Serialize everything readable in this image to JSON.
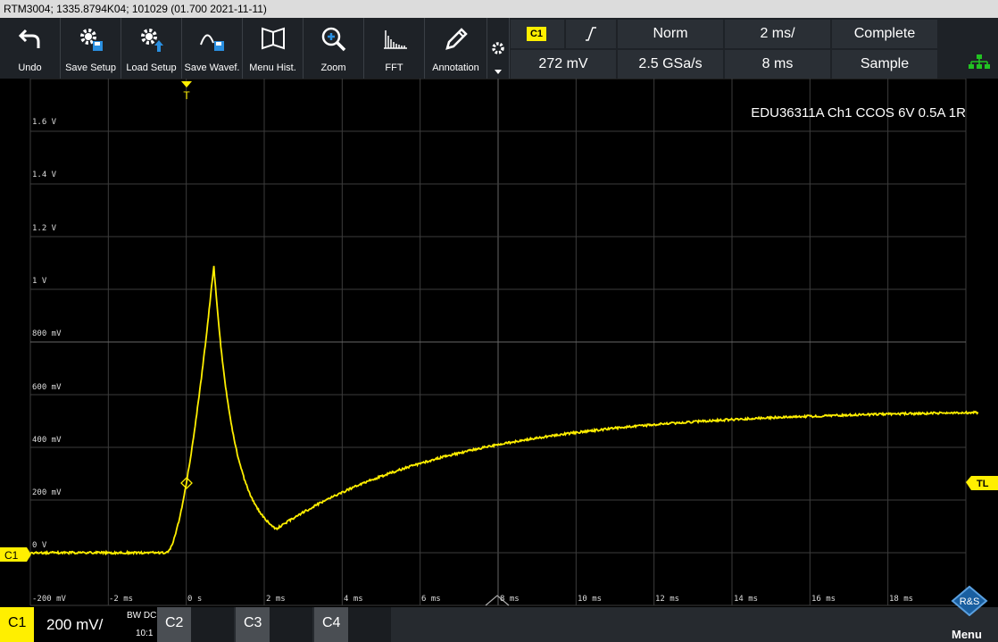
{
  "titlebar": {
    "text": "RTM3004; 1335.8794K04; 101029 (01.700 2021-11-11)"
  },
  "toolbar": {
    "undo": "Undo",
    "save_setup": "Save Setup",
    "load_setup": "Load Setup",
    "save_waveform": "Save Wavef.",
    "menu_hist": "Menu Hist.",
    "zoom": "Zoom",
    "fft": "FFT",
    "annotation": "Annotation"
  },
  "info": {
    "channel": "C1",
    "trigger_level": "272 mV",
    "trigger_mode": "Norm",
    "sample_rate": "2.5 GSa/s",
    "timebase": "2 ms/",
    "record_time": "8 ms",
    "acq_status": "Complete",
    "acq_mode": "Sample"
  },
  "plot": {
    "annotation": "EDU36311A Ch1 CCOS 6V 0.5A 1R",
    "trigger_marker": "T",
    "trigger_level_marker": "TL",
    "channel_marker": "C1",
    "y_labels": [
      "1.6 V",
      "1.4 V",
      "1.2 V",
      "1 V",
      "800 mV",
      "600 mV",
      "400 mV",
      "200 mV",
      "0 V",
      "-200 mV"
    ],
    "x_labels": [
      "-2 ms",
      "0 s",
      "2 ms",
      "4 ms",
      "6 ms",
      "8 ms",
      "10 ms",
      "12 ms",
      "14 ms",
      "16 ms",
      "18 ms"
    ]
  },
  "bottom": {
    "c1": "C1",
    "scale": "200 mV/",
    "coupling": "BW DC",
    "probe": "10:1",
    "c2": "C2",
    "c3": "C3",
    "c4": "C4",
    "menu": "Menu"
  },
  "colors": {
    "trace": "#ffef00",
    "grid": "#4a4a4a",
    "accent": "#ffef00"
  }
}
